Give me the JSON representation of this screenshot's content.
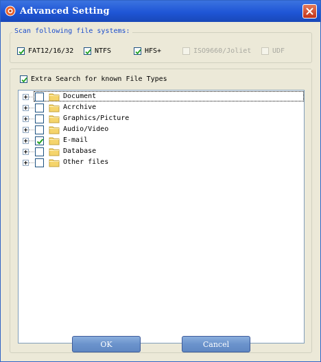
{
  "window": {
    "title": "Advanced Setting",
    "icon": "app-icon",
    "close_icon": "close-icon"
  },
  "filesystems": {
    "legend": "Scan following file systems:",
    "items": [
      {
        "label": "FAT12/16/32",
        "checked": true,
        "enabled": true
      },
      {
        "label": "NTFS",
        "checked": true,
        "enabled": true
      },
      {
        "label": "HFS+",
        "checked": true,
        "enabled": true
      },
      {
        "label": "ISO9660/Joliet",
        "checked": false,
        "enabled": false
      },
      {
        "label": "UDF",
        "checked": false,
        "enabled": false
      }
    ]
  },
  "extra_search": {
    "label": "Extra Search for known File Types",
    "checked": true
  },
  "file_types": [
    {
      "label": "Document",
      "checked": false,
      "icon": "folder-icon",
      "focused": true
    },
    {
      "label": "Acrchive",
      "checked": false,
      "icon": "folder-icon"
    },
    {
      "label": "Graphics/Picture",
      "checked": false,
      "icon": "folder-icon"
    },
    {
      "label": "Audio/Video",
      "checked": false,
      "icon": "folder-icon"
    },
    {
      "label": "E-mail",
      "checked": true,
      "icon": "folder-icon"
    },
    {
      "label": "Database",
      "checked": false,
      "icon": "folder-icon"
    },
    {
      "label": "Other files",
      "checked": false,
      "icon": "folder-icon"
    }
  ],
  "buttons": {
    "ok": "OK",
    "cancel": "Cancel"
  },
  "colors": {
    "titlebar": "#1f56d6",
    "legend_text": "#1a4ccc",
    "button": "#6b93cc",
    "check": "#21a121",
    "folder": "#f5d46b"
  }
}
